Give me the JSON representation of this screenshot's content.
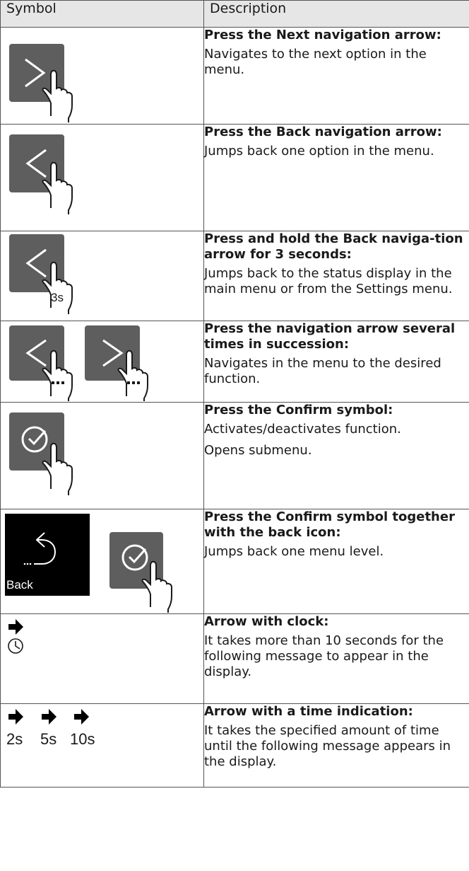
{
  "table": {
    "header": {
      "symbol": "Symbol",
      "description": "Description"
    },
    "rows": [
      {
        "icon": "next-arrow-touch-icon",
        "title": "Press the Next navigation arrow:",
        "text": [
          "Navigates to the next option in the menu."
        ]
      },
      {
        "icon": "back-arrow-touch-icon",
        "title": "Press the Back navigation arrow:",
        "text": [
          "Jumps back one option in the menu."
        ]
      },
      {
        "icon": "back-arrow-hold-3s-icon",
        "title": "Press and hold the Back naviga-tion arrow for 3 seconds:",
        "text": [
          "Jumps back to the status display in the main menu or from the Settings menu."
        ]
      },
      {
        "icon": "multi-press-arrows-icon",
        "title": "Press the navigation arrow several times in succession:",
        "text": [
          "Navigates in the menu to the desired function."
        ]
      },
      {
        "icon": "confirm-touch-icon",
        "title": "Press the Confirm symbol:",
        "text": [
          "Activates/deactivates function.",
          "Opens submenu."
        ]
      },
      {
        "icon": "back-confirm-combo-icon",
        "title": "Press the Confirm symbol together with the back icon:",
        "text": [
          "Jumps back one menu level."
        ]
      },
      {
        "icon": "arrow-clock-icon",
        "title": "Arrow with clock:",
        "text": [
          "It takes more than 10 seconds for the following message to appear in the display."
        ]
      },
      {
        "icon": "arrow-time-indication-icon",
        "title": "Arrow with a time indication:",
        "text": [
          "It takes the specified amount of time until the following message appears in the display."
        ]
      }
    ],
    "labels": {
      "hold_duration": "3s",
      "back_label": "Back",
      "time_a": "2s",
      "time_b": "5s",
      "time_c": "10s"
    }
  },
  "colors": {
    "button_fill": "#5e5e5e",
    "header_bg": "#e6e6e6",
    "border": "#555555"
  }
}
